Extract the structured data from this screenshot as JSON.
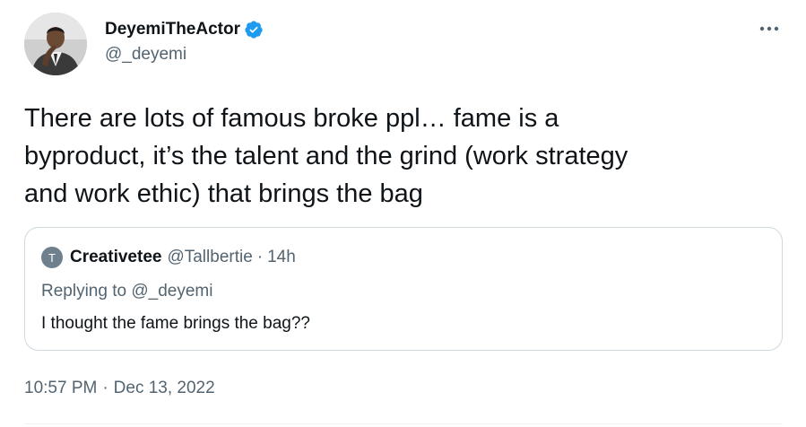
{
  "author": {
    "display_name": "DeyemiTheActor",
    "handle": "@_deyemi",
    "verified_icon": "verified-badge-icon",
    "verified_color": "#1d9bf0"
  },
  "tweet": {
    "text": "There are lots of famous broke ppl… fame is a\nbyproduct, it’s the talent and the grind (work strategy\nand work ethic) that brings the bag",
    "time": "10:57 PM",
    "separator": "·",
    "date": "Dec 13, 2022"
  },
  "quoted": {
    "avatar_initial": "T",
    "display_name": "Creativetee",
    "handle": "@Tallbertie",
    "separator": "·",
    "time": "14h",
    "replying_prefix": "Replying to",
    "replying_handle": "@_deyemi",
    "text": "I thought the fame brings the bag??"
  },
  "icons": {
    "more": "more-horizontal-icon"
  },
  "colors": {
    "text_primary": "#0f1419",
    "text_secondary": "#536471",
    "border": "#cfd9de"
  }
}
